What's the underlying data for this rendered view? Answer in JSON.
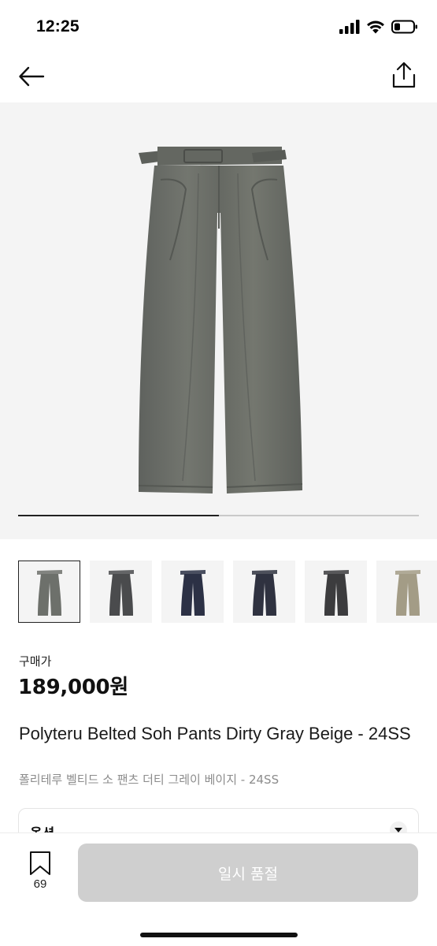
{
  "status_bar": {
    "time": "12:25"
  },
  "product": {
    "gallery": {
      "progress": 0.5,
      "current_color": "#6f726e"
    },
    "thumbnails": [
      {
        "name": "dirty gray beige",
        "color": "#6d706b",
        "selected": true
      },
      {
        "name": "charcoal",
        "color": "#4a4b4d",
        "selected": false
      },
      {
        "name": "navy",
        "color": "#2c3145",
        "selected": false
      },
      {
        "name": "dark navy",
        "color": "#2f3240",
        "selected": false
      },
      {
        "name": "black",
        "color": "#3c3c3e",
        "selected": false
      },
      {
        "name": "beige",
        "color": "#a39c86",
        "selected": false
      }
    ],
    "price_label": "구매가",
    "price": "189,000원",
    "title_en": "Polyteru Belted Soh Pants Dirty Gray Beige - 24SS",
    "title_ko": "폴리테루 벨티드 소 팬츠 더티 그레이 베이지 - 24SS"
  },
  "options": {
    "label": "옵션"
  },
  "bottom_bar": {
    "bookmark_count": "69",
    "soldout_label": "일시 품절"
  },
  "colors": {
    "disabled_button": "#cfcfcf",
    "hero_background": "#f4f4f4"
  }
}
